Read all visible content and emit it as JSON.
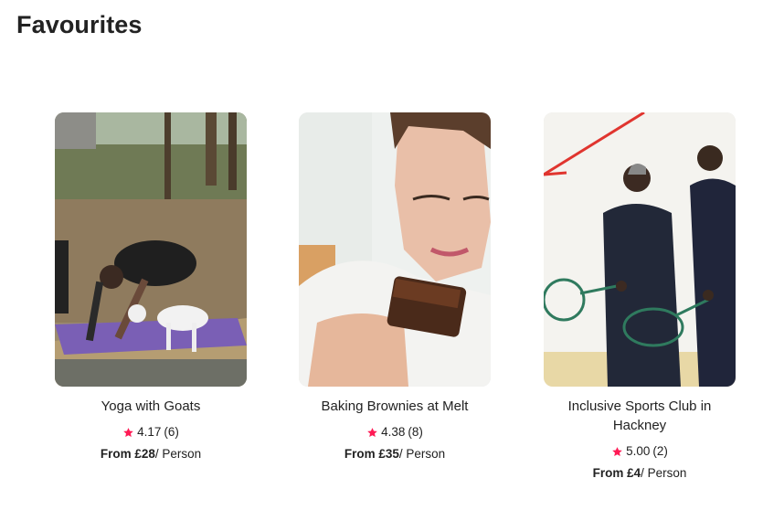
{
  "page": {
    "title": "Favourites"
  },
  "colors": {
    "star": "#ff1a55",
    "text": "#222222"
  },
  "cards": [
    {
      "title": "Yoga with Goats",
      "rating": "4.17",
      "reviews": "(6)",
      "price_prefix": "From £28",
      "price_suffix": "/ Person",
      "image": "photo of people doing yoga on a mat outdoors with a goat"
    },
    {
      "title": "Baking Brownies at Melt",
      "rating": "4.38",
      "reviews": "(8)",
      "price_prefix": "From £35",
      "price_suffix": "/ Person",
      "image": "photo of a woman smelling a chocolate brownie"
    },
    {
      "title": "Inclusive Sports Club in Hackney",
      "rating": "5.00",
      "reviews": "(2)",
      "price_prefix": "From £4",
      "price_suffix": "/ Person",
      "image": "photo of two people holding squash rackets in a squash court"
    }
  ],
  "icons": {
    "star": "star-icon"
  }
}
